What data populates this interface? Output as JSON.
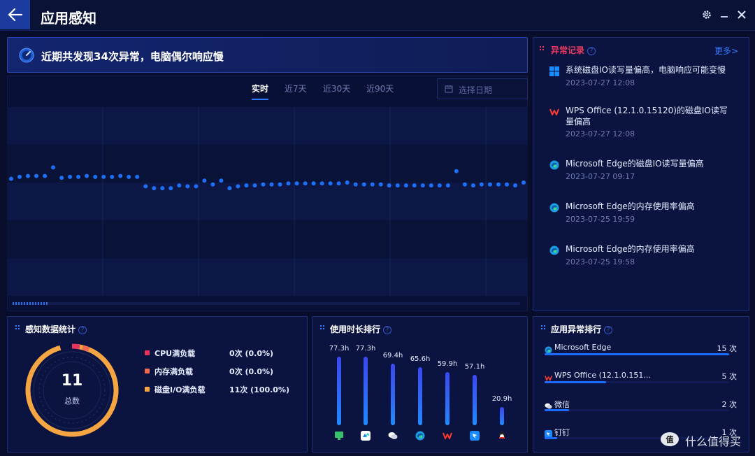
{
  "header": {
    "title": "应用感知"
  },
  "banner": {
    "text": "近期共发现34次异常，电脑偶尔响应慢"
  },
  "tabs": [
    {
      "label": "实时",
      "active": true
    },
    {
      "label": "近7天",
      "active": false
    },
    {
      "label": "近30天",
      "active": false
    },
    {
      "label": "近90天",
      "active": false
    }
  ],
  "date_picker": {
    "placeholder": "选择日期"
  },
  "chart_data": {
    "type": "scatter",
    "values": [
      62,
      63,
      63.5,
      63.5,
      63.5,
      68,
      62.5,
      63,
      63,
      63.5,
      63,
      63,
      63,
      63.5,
      63,
      63,
      58,
      57,
      57,
      57,
      58.5,
      58,
      58,
      61,
      59,
      61,
      57,
      58,
      58.5,
      58.5,
      59,
      59,
      59,
      59.5,
      59.5,
      59.5,
      59.5,
      59.5,
      59.5,
      59.5,
      60,
      59,
      59,
      59,
      59,
      58.5,
      58.5,
      58.5,
      58.5,
      58.5,
      58.5,
      58.5,
      58.5,
      66,
      59,
      58.5,
      59,
      59,
      59,
      59,
      58.5,
      60
    ],
    "ylim": [
      0,
      100
    ],
    "grid": true
  },
  "anomaly_panel": {
    "title": "异常记录",
    "more": "更多>",
    "items": [
      {
        "icon": "windows-icon",
        "text": "系统磁盘IO读写量偏高，电脑响应可能变慢",
        "time": "2023-07-27 12:08"
      },
      {
        "icon": "wps-icon",
        "text": "WPS Office (12.1.0.15120)的磁盘IO读写量偏高",
        "time": "2023-07-27 12:08"
      },
      {
        "icon": "edge-icon",
        "text": "Microsoft Edge的磁盘IO读写量偏高",
        "time": "2023-07-27 09:17"
      },
      {
        "icon": "edge-icon",
        "text": "Microsoft Edge的内存使用率偏高",
        "time": "2023-07-25 19:59"
      },
      {
        "icon": "edge-icon",
        "text": "Microsoft Edge的内存使用率偏高",
        "time": "2023-07-25 19:58"
      }
    ]
  },
  "stats_panel": {
    "title": "感知数据统计",
    "total_value": "11",
    "total_label": "总数",
    "legend": [
      {
        "label": "CPU满负载",
        "value": "0次 (0.0%)",
        "color": "#e8345a"
      },
      {
        "label": "内存满负载",
        "value": "0次 (0.0%)",
        "color": "#f06a50"
      },
      {
        "label": "磁盘I/O满负载",
        "value": "11次 (100.0%)",
        "color": "#f5a542"
      }
    ]
  },
  "usage_panel": {
    "title": "使用时长排行",
    "bars": [
      {
        "label": "77.3h",
        "value": 77.3,
        "icon": "monitor-icon"
      },
      {
        "label": "77.3h",
        "value": 77.3,
        "icon": "tencent-meeting-icon"
      },
      {
        "label": "69.4h",
        "value": 69.4,
        "icon": "wechat-icon"
      },
      {
        "label": "65.6h",
        "value": 65.6,
        "icon": "edge-icon"
      },
      {
        "label": "59.9h",
        "value": 59.9,
        "icon": "wps-icon"
      },
      {
        "label": "57.1h",
        "value": 57.1,
        "icon": "dingtalk-icon"
      },
      {
        "label": "20.9h",
        "value": 20.9,
        "icon": "qq-icon"
      }
    ]
  },
  "rank_panel": {
    "title": "应用异常排行",
    "rows": [
      {
        "name": "Microsoft Edge",
        "count": "15 次",
        "value": 15,
        "icon": "edge-icon"
      },
      {
        "name": "WPS Office (12.1.0.151...",
        "count": "5 次",
        "value": 5,
        "icon": "wps-icon"
      },
      {
        "name": "微信",
        "count": "2 次",
        "value": 2,
        "icon": "wechat-icon"
      },
      {
        "name": "钉钉",
        "count": "1 次",
        "value": 1,
        "icon": "dingtalk-icon"
      }
    ]
  },
  "watermark": {
    "text": "什么值得买"
  },
  "colors": {
    "accent": "#2f7bff",
    "alert": "#e83a5e",
    "ring": "#f5a542"
  }
}
